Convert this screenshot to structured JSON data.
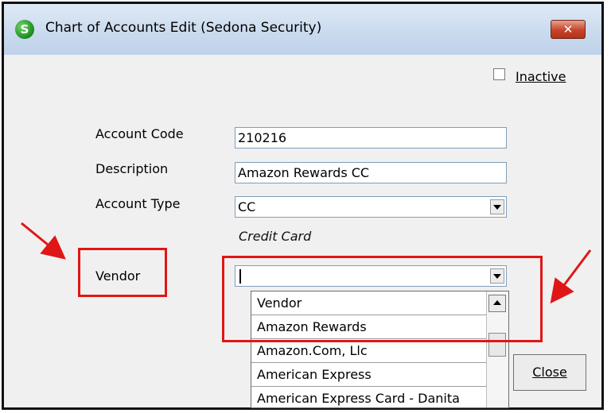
{
  "window": {
    "title": "Chart of Accounts Edit  (Sedona Security)",
    "app_icon_letter": "S",
    "close_glyph": "✕"
  },
  "inactive": {
    "label": "Inactive",
    "checked": false
  },
  "form": {
    "account_code": {
      "label": "Account Code",
      "value": "210216"
    },
    "description": {
      "label": "Description",
      "value": "Amazon Rewards CC"
    },
    "account_type": {
      "label": "Account Type",
      "value": "CC",
      "hint": "Credit Card"
    },
    "vendor": {
      "label": "Vendor",
      "value": ""
    }
  },
  "vendor_dropdown": {
    "header": "Vendor",
    "options": [
      "Amazon Rewards",
      "Amazon.Com, Llc",
      "American Express",
      "American Express Card - Danita"
    ]
  },
  "buttons": {
    "close": "Close"
  },
  "colors": {
    "annotation": "#e01616",
    "titlebar": "#c9daee",
    "close_button": "#c7432a"
  }
}
